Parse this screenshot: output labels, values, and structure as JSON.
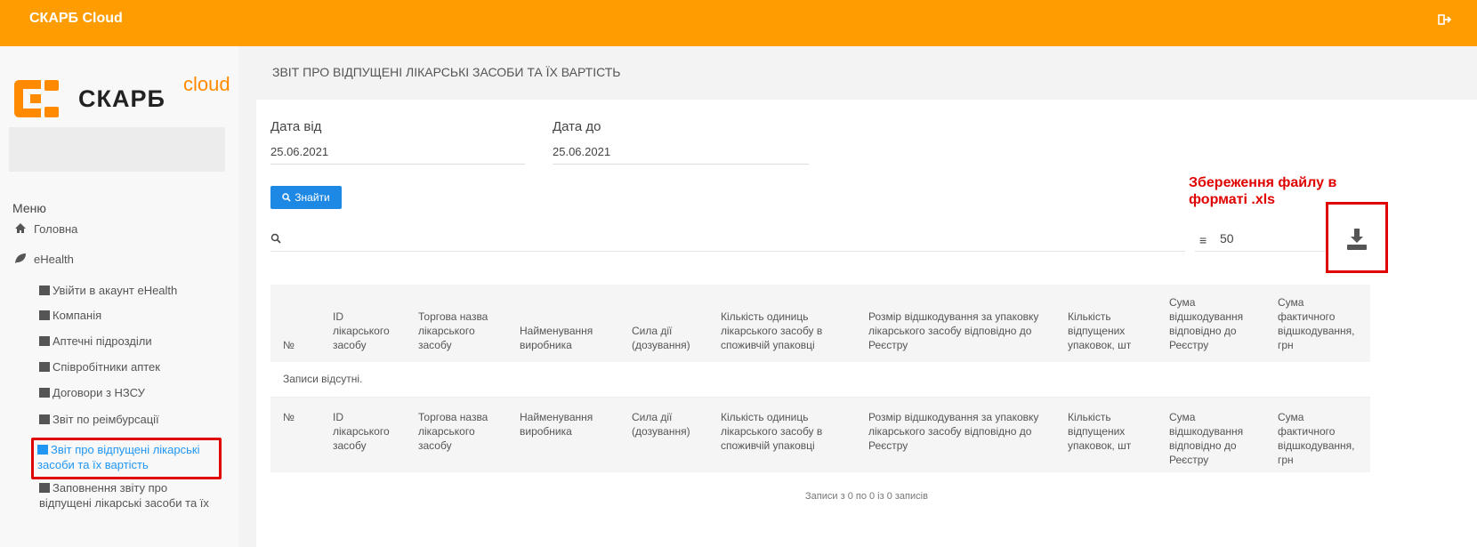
{
  "header": {
    "app_title": "СКАРБ Cloud",
    "logout_icon": "logout-icon",
    "color": "#ff9c00"
  },
  "sidebar": {
    "logo_text": "СКАРБ",
    "logo_sub": "cloud",
    "menu_title": "Меню",
    "items": [
      {
        "label": "Головна",
        "icon": "home-icon"
      },
      {
        "label": "eHealth",
        "icon": "leaf-icon"
      }
    ],
    "sub_items": [
      {
        "label": "Увійти в акаунт eHealth",
        "icon": "login-icon"
      },
      {
        "label": "Компанія",
        "icon": "database-icon"
      },
      {
        "label": "Аптечні підрозділи",
        "icon": "plus-square-icon"
      },
      {
        "label": "Співробітники аптек",
        "icon": "users-icon"
      },
      {
        "label": "Договори з НЗСУ",
        "icon": "file-icon"
      },
      {
        "label": "Звіт по реімбурсації",
        "icon": "file-icon"
      },
      {
        "label": "Звіт про відпущені лікарські засоби та їх вартість",
        "icon": "file-icon",
        "active": true
      },
      {
        "label": "Заповнення звіту про відпущені лікарські засоби та їх",
        "icon": "file-icon"
      }
    ]
  },
  "main": {
    "page_title": "ЗВІТ ПРО ВІДПУЩЕНІ ЛІКАРСЬКІ ЗАСОБИ ТА ЇХ ВАРТІСТЬ",
    "date_from_label": "Дата від",
    "date_from_value": "25.06.2021",
    "date_to_label": "Дата до",
    "date_to_value": "25.06.2021",
    "find_button": "Знайти",
    "per_page": "50",
    "annotation": "Збереження файлу в форматі .xls",
    "columns": [
      "№",
      "ID лікарського засобу",
      "Торгова назва лікарського засобу",
      "Найменування виробника",
      "Сила дії (дозування)",
      "Кількість одиниць лікарського засобу в споживчій упаковці",
      "Розмір відшкодування за упаковку лікарського засобу відповідно до Реєстру",
      "Кількість відпущених упаковок, шт",
      "Сума відшкодування відповідно до Реєстру",
      "Сума фактичного відшкодування, грн"
    ],
    "empty_text": "Записи відсутні.",
    "footer_info": "Записи з 0 по 0 із 0 записів"
  }
}
